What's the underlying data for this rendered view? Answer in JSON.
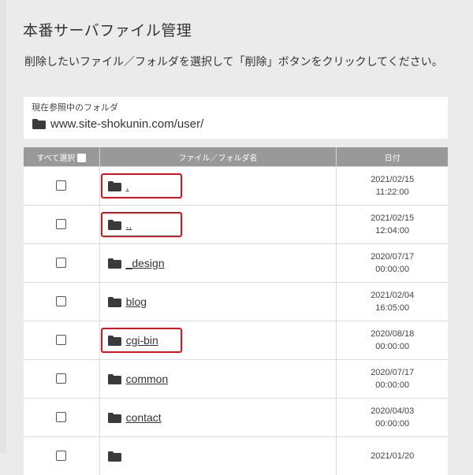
{
  "page": {
    "title": "本番サーバファイル管理",
    "description": "削除したいファイル／フォルダを選択して「削除」ボタンをクリックしてください。"
  },
  "current_folder": {
    "label": "現在参照中のフォルダ",
    "path": "www.site-shokunin.com/user/"
  },
  "table": {
    "headers": {
      "select_all": "すべて選択",
      "name": "ファイル／フォルダ名",
      "date": "日付"
    },
    "rows": [
      {
        "name": ".",
        "date": "2021/02/15",
        "time": "11:22:00",
        "highlighted": true
      },
      {
        "name": "..",
        "date": "2021/02/15",
        "time": "12:04:00",
        "highlighted": true
      },
      {
        "name": "_design",
        "date": "2020/07/17",
        "time": "00:00:00",
        "highlighted": false
      },
      {
        "name": "blog",
        "date": "2021/02/04",
        "time": "16:05:00",
        "highlighted": false
      },
      {
        "name": "cgi-bin",
        "date": "2020/08/18",
        "time": "00:00:00",
        "highlighted": true
      },
      {
        "name": "common",
        "date": "2020/07/17",
        "time": "00:00:00",
        "highlighted": false
      },
      {
        "name": "contact",
        "date": "2020/04/03",
        "time": "00:00:00",
        "highlighted": false
      },
      {
        "name": "",
        "date": "2021/01/20",
        "time": "",
        "highlighted": false
      }
    ]
  },
  "colors": {
    "header_bg": "#999999",
    "highlight_border": "#e0101e",
    "page_bg": "#ebebeb"
  },
  "icons": {
    "folder": "folder-icon"
  }
}
